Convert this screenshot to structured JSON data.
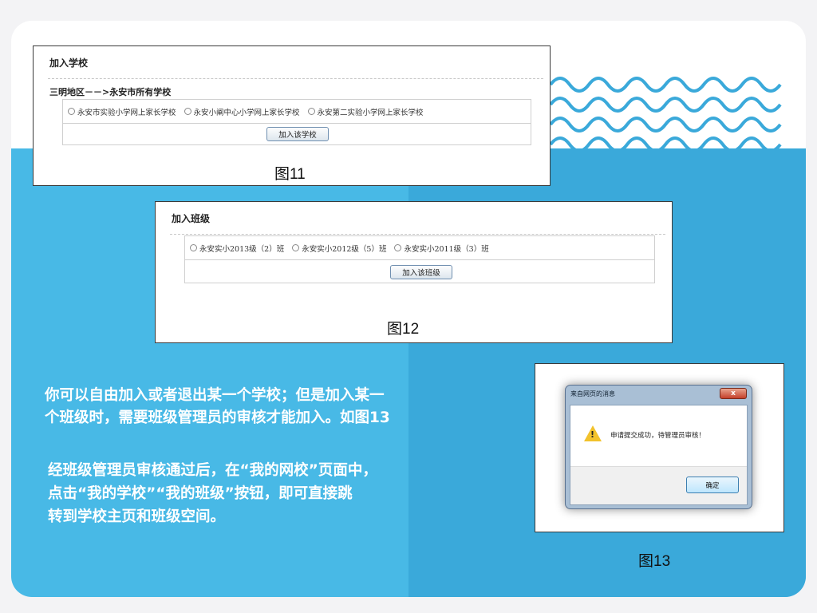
{
  "fig11": {
    "title": "加入学校",
    "subtitle": "三明地区－－>永安市所有学校",
    "options": [
      "永安市实验小学网上家长学校",
      "永安小阐中心小学网上家长学校",
      "永安第二实验小学网上家长学校"
    ],
    "button": "加入该学校",
    "caption": "图11"
  },
  "fig12": {
    "title": "加入班级",
    "options": [
      "永安实小2013级（2）班",
      "永安实小2012级（5）班",
      "永安实小2011级（3）班"
    ],
    "button": "加入该班级",
    "caption": "图12"
  },
  "text": {
    "para1_line1": "你可以自由加入或者退出某一个学校；但是加入某一",
    "para1_line2": "个班级时，需要班级管理员的审核才能加入。如图13",
    "para2_line1": "经班级管理员审核通过后，在“我的网校”页面中，",
    "para2_line2": "点击“我的学校”“我的班级”按钮，即可直接跳",
    "para2_line3": "转到学校主页和班级空间。"
  },
  "fig13": {
    "dialog_title": "来自网页的消息",
    "close": "x",
    "message": "申请提交成功，待管理员审核！",
    "ok": "确定",
    "caption": "图13"
  },
  "colors": {
    "band": "#48b9e6",
    "band_dark": "#3aa9da",
    "waves": "#3aa9da"
  }
}
